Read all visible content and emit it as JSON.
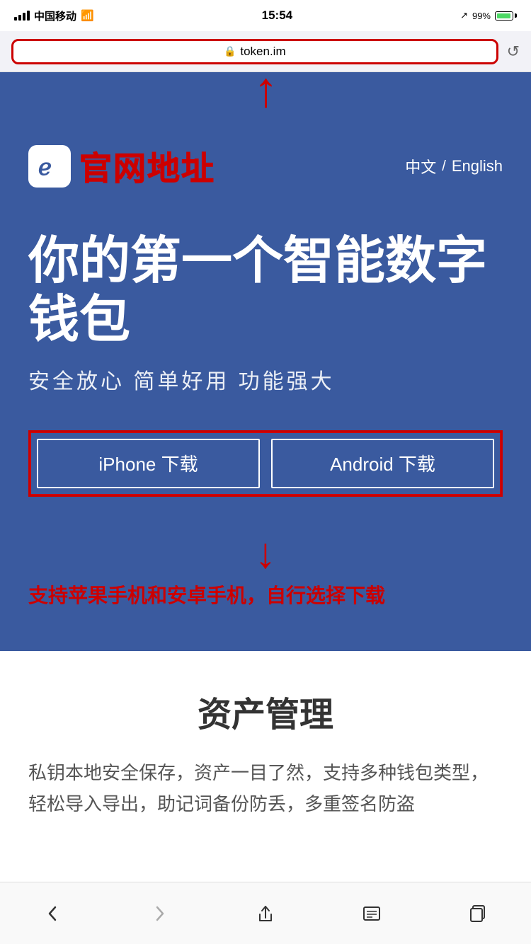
{
  "statusBar": {
    "carrier": "中国移动",
    "time": "15:54",
    "battery": "99%",
    "signal": "wifi"
  },
  "browserBar": {
    "url": "token.im",
    "lockIcon": "🔒",
    "reloadIcon": "↺"
  },
  "siteHeader": {
    "logoIcon": "e",
    "title": "官网地址",
    "langChinese": "中文",
    "langDivider": "/",
    "langEnglish": "English"
  },
  "hero": {
    "title": "你的第一个智能数字钱包",
    "subtitle": "安全放心  简单好用  功能强大",
    "iphoneBtn": "iPhone 下载",
    "androidBtn": "Android 下载"
  },
  "annotation": {
    "text": "支持苹果手机和安卓手机，自行选择下载"
  },
  "assetSection": {
    "title": "资产管理",
    "body": "私钥本地安全保存，资产一目了然，支持多种钱包类型，轻松导入导出，助记词备份防丢，多重签名防盗"
  },
  "bottomNav": {
    "back": "‹",
    "forward": "›",
    "share": "⬆",
    "bookmarks": "📖",
    "tabs": "⧉"
  }
}
